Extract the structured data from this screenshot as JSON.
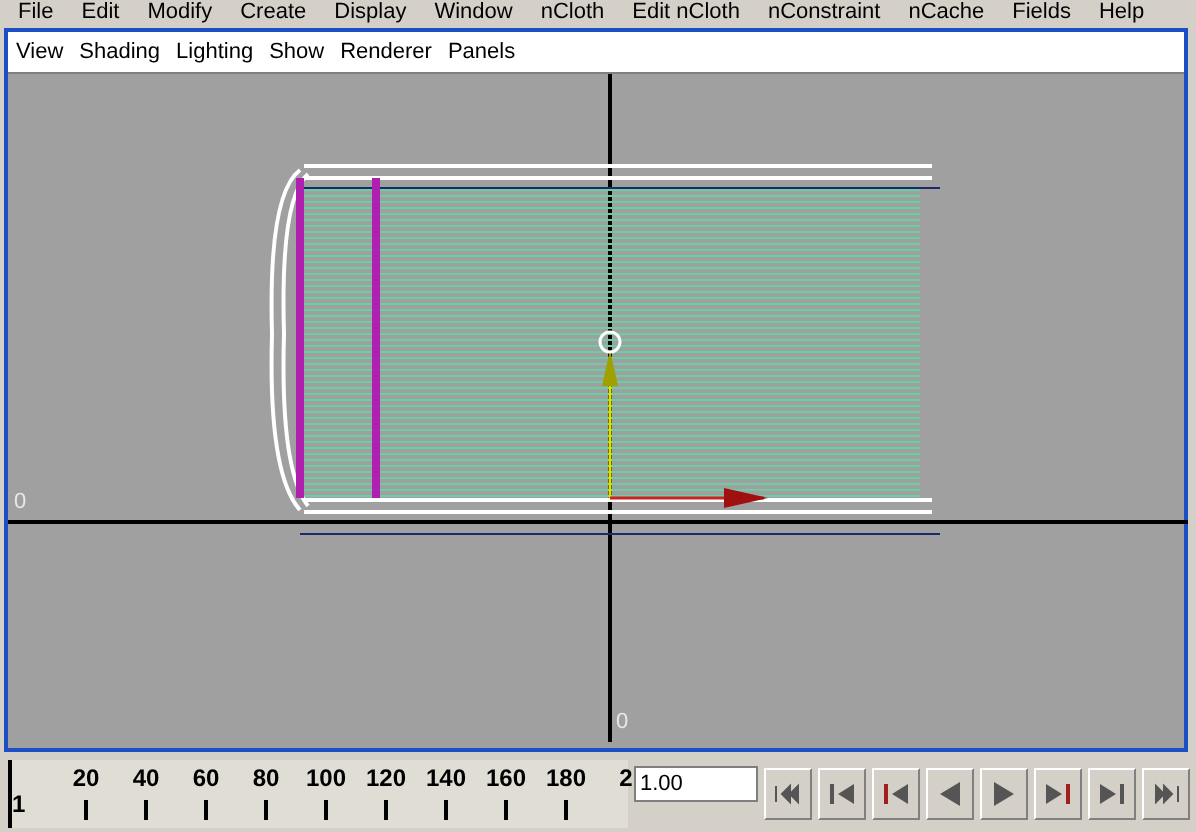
{
  "menu_bar": [
    "File",
    "Edit",
    "Modify",
    "Create",
    "Display",
    "Window",
    "nCloth",
    "Edit nCloth",
    "nConstraint",
    "nCache",
    "Fields",
    "Help"
  ],
  "panel_menu": [
    "View",
    "Shading",
    "Lighting",
    "Show",
    "Renderer",
    "Panels"
  ],
  "viewport": {
    "axis_labels": [
      "0",
      "0"
    ]
  },
  "time_slider": {
    "level": 0,
    "current_frame": "1",
    "ticks": [
      "20",
      "40",
      "60",
      "80",
      "100",
      "120",
      "140",
      "160",
      "180",
      "2"
    ]
  },
  "frame_field": {
    "value": "1.00"
  },
  "playback_buttons": [
    {
      "kind": "go-start"
    },
    {
      "kind": "step-back-key"
    },
    {
      "kind": "step-back"
    },
    {
      "kind": "play-back"
    },
    {
      "kind": "play-forward"
    },
    {
      "kind": "step-forward"
    },
    {
      "kind": "step-forward-key"
    },
    {
      "kind": "go-end"
    }
  ]
}
